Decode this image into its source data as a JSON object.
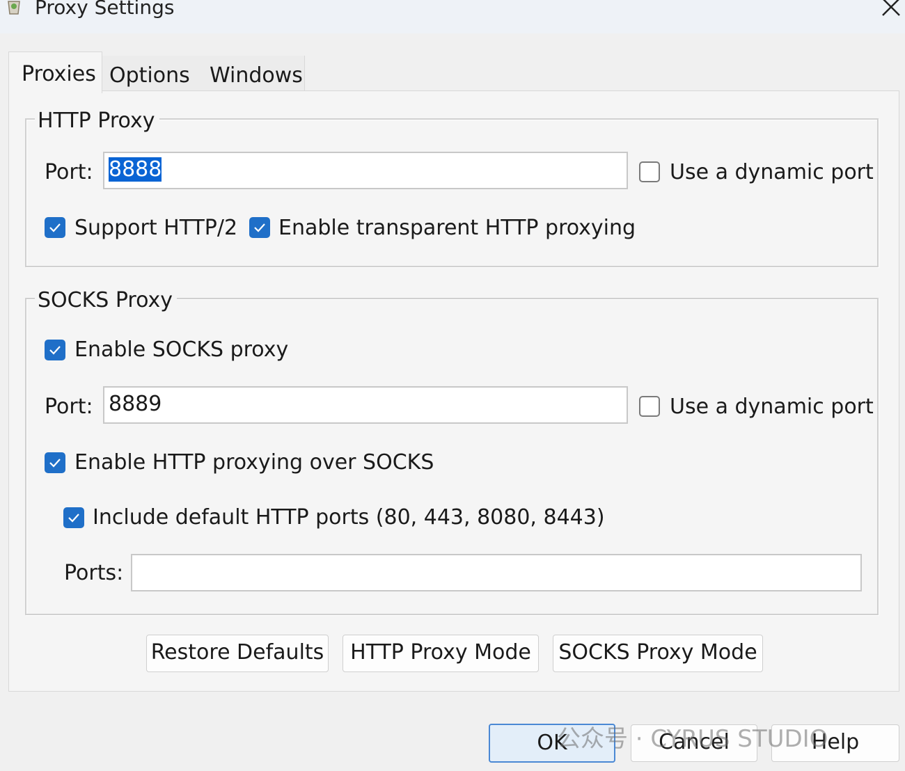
{
  "window": {
    "title": "Proxy Settings",
    "app_icon": "fiddler-icon",
    "close_icon": "close-icon"
  },
  "tabs": [
    {
      "label": "Proxies",
      "active": true
    },
    {
      "label": "Options",
      "active": false
    },
    {
      "label": "Windows",
      "active": false
    }
  ],
  "http_proxy": {
    "legend": "HTTP Proxy",
    "port_label": "Port:",
    "port_value": "8888",
    "dynamic_port_label": "Use a dynamic port",
    "dynamic_port_checked": false,
    "support_http2_label": "Support HTTP/2",
    "support_http2_checked": true,
    "transparent_label": "Enable transparent HTTP proxying",
    "transparent_checked": true
  },
  "socks_proxy": {
    "legend": "SOCKS Proxy",
    "enable_label": "Enable SOCKS proxy",
    "enable_checked": true,
    "port_label": "Port:",
    "port_value": "8889",
    "dynamic_port_label": "Use a dynamic port",
    "dynamic_port_checked": false,
    "http_over_socks_label": "Enable HTTP proxying over SOCKS",
    "http_over_socks_checked": true,
    "include_default_label": "Include default HTTP ports (80, 443, 8080, 8443)",
    "include_default_checked": true,
    "ports_label": "Ports:",
    "ports_value": ""
  },
  "panel_buttons": {
    "restore_defaults": "Restore Defaults",
    "http_mode": "HTTP Proxy Mode",
    "socks_mode": "SOCKS Proxy Mode"
  },
  "dialog_buttons": {
    "ok": "OK",
    "cancel": "Cancel",
    "help": "Help"
  },
  "watermark": "公众号 · CYRUS STUDIO",
  "colors": {
    "checkbox_checked": "#1f6fc8",
    "selection": "#0a64d4",
    "ok_border": "#4a88d4"
  }
}
